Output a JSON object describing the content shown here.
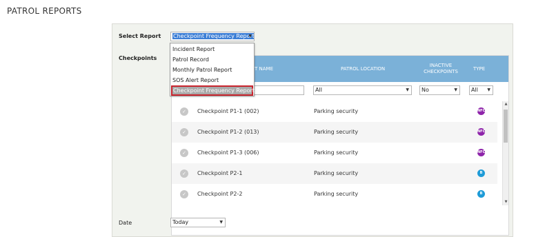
{
  "page_title": "PATROL REPORTS",
  "select_report": {
    "label": "Select Report",
    "value": "Checkpoint Frequency Report",
    "options": [
      "Incident Report",
      "Patrol Record",
      "Monthly Patrol Report",
      "SOS Alert Report",
      "Checkpoint Frequency Report"
    ]
  },
  "checkpoints": {
    "label": "Checkpoints",
    "headers": {
      "name": "T NAME",
      "location": "PATROL LOCATION",
      "inactive_line1": "INACTIVE",
      "inactive_line2": "CHECKPOINTS",
      "type": "TYPE"
    },
    "filters": {
      "location": "All",
      "inactive": "No",
      "type": "All"
    },
    "rows": [
      {
        "name": "Checkpoint P1-1 (002)",
        "location": "Parking security",
        "type_icon": "nfc-icon",
        "type_color": "#8e24aa",
        "type_glyph": "NFC"
      },
      {
        "name": "Checkpoint P1-2 (013)",
        "location": "Parking security",
        "type_icon": "nfc-icon",
        "type_color": "#8e24aa",
        "type_glyph": "NFC"
      },
      {
        "name": "Checkpoint P1-3 (006)",
        "location": "Parking security",
        "type_icon": "nfc-icon",
        "type_color": "#8e24aa",
        "type_glyph": "NFC"
      },
      {
        "name": "Checkpoint P2-1",
        "location": "Parking security",
        "type_icon": "bluetooth-icon",
        "type_color": "#1e9bd7",
        "type_glyph": "B"
      },
      {
        "name": "Checkpoint P2-2",
        "location": "Parking security",
        "type_icon": "bluetooth-icon",
        "type_color": "#1e9bd7",
        "type_glyph": "B"
      }
    ]
  },
  "date": {
    "label": "Date",
    "value": "Today"
  },
  "colors": {
    "header_bg": "#7bb1d8",
    "selected_outline": "#c9232d"
  }
}
